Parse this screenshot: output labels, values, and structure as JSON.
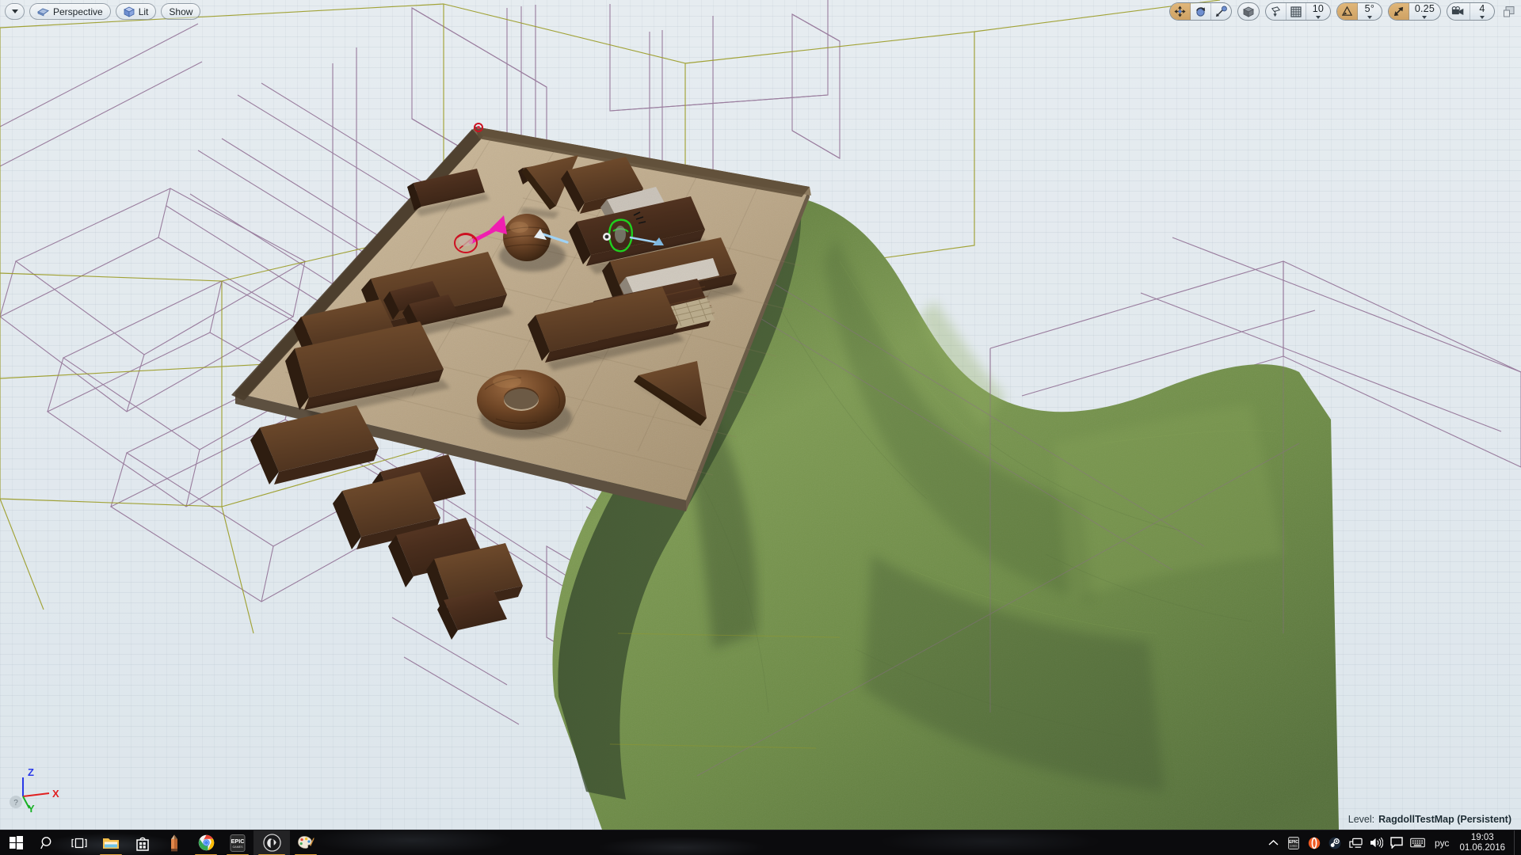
{
  "app": {
    "name": "Unreal Engine Editor",
    "level_label": "Level:",
    "level_name": "RagdollTestMap (Persistent)"
  },
  "viewport": {
    "toolbar_left": [
      {
        "name": "viewport-options-caret",
        "icon": "chevron-down-icon",
        "label": ""
      },
      {
        "name": "camera-mode",
        "icon": "camera-icon",
        "label": "Perspective"
      },
      {
        "name": "view-mode",
        "icon": "cube-icon",
        "label": "Lit"
      },
      {
        "name": "show-menu",
        "icon": "",
        "label": "Show"
      }
    ],
    "toolbar_right": {
      "transform_group": [
        {
          "name": "translate-mode",
          "icon": "move-icon",
          "active": true
        },
        {
          "name": "rotate-mode",
          "icon": "rotate-icon",
          "active": false
        },
        {
          "name": "scale-mode",
          "icon": "scale-icon",
          "active": false
        }
      ],
      "coord_group": [
        {
          "name": "world-coordinate-toggle",
          "icon": "globe-cube-icon",
          "active": false
        }
      ],
      "snap_group": [
        {
          "name": "surface-snap-toggle",
          "icon": "surface-snap-icon",
          "active": false
        },
        {
          "name": "grid-snap-toggle",
          "icon": "grid-icon",
          "active": false
        },
        {
          "name": "grid-snap-value",
          "icon": "",
          "value": "10",
          "active": false
        }
      ],
      "rotation_group": [
        {
          "name": "rotation-snap-toggle",
          "icon": "angle-icon",
          "active": true
        },
        {
          "name": "rotation-snap-value",
          "icon": "",
          "value": "5°",
          "active": false
        }
      ],
      "scale_group": [
        {
          "name": "scale-snap-toggle",
          "icon": "scale-arrow-icon",
          "active": true
        },
        {
          "name": "scale-snap-value",
          "icon": "",
          "value": "0.25",
          "active": false
        }
      ],
      "camera_group": [
        {
          "name": "camera-speed-toggle",
          "icon": "movie-camera-icon",
          "active": false
        },
        {
          "name": "camera-speed-value",
          "icon": "",
          "value": "4",
          "active": false
        }
      ],
      "maximize": {
        "name": "maximize-viewport-button",
        "icon": "maximize-icon"
      }
    },
    "axis_gizmo": {
      "z": "Z",
      "x": "X",
      "y": "Y",
      "z_color": "#2a39e8",
      "x_color": "#e02020",
      "y_color": "#17b024"
    },
    "colors": {
      "background": "#e3eaee",
      "wire_olive": "#9a9b22",
      "wire_purple": "#8d6a90",
      "floor_tan": "#b5a183",
      "wood_dark": "#4d3322",
      "grass_green": "#6e8c45",
      "selection_red": "#cc1122",
      "selection_green": "#1fd11f",
      "velocity_magenta": "#ef1fb0",
      "constraint_blue": "#9fd2f5",
      "toolbar_active": "#cfa263"
    }
  },
  "taskbar": {
    "items": [
      {
        "name": "start-button",
        "icon": "windows-logo-icon",
        "running": false,
        "active": false
      },
      {
        "name": "search-button",
        "icon": "search-icon",
        "running": false,
        "active": false
      },
      {
        "name": "task-view-button",
        "icon": "task-view-icon",
        "running": false,
        "active": false
      },
      {
        "name": "file-explorer-button",
        "icon": "folder-icon",
        "running": true,
        "active": false
      },
      {
        "name": "microsoft-store-button",
        "icon": "store-bag-icon",
        "running": false,
        "active": false
      },
      {
        "name": "sticky-notes-button",
        "icon": "pencil-icon",
        "running": false,
        "active": false
      },
      {
        "name": "google-chrome-button",
        "icon": "chrome-icon",
        "running": true,
        "active": false
      },
      {
        "name": "epic-games-launcher-button",
        "icon": "epic-games-icon",
        "running": true,
        "active": false
      },
      {
        "name": "unreal-engine-button",
        "icon": "unreal-engine-icon",
        "running": true,
        "active": true
      },
      {
        "name": "paint-button",
        "icon": "paint-palette-icon",
        "running": true,
        "active": false
      }
    ],
    "tray": [
      {
        "name": "show-hidden-icons-button",
        "icon": "chevron-up-icon"
      },
      {
        "name": "tray-epic-games",
        "icon": "epic-games-icon"
      },
      {
        "name": "tray-origin",
        "icon": "origin-icon"
      },
      {
        "name": "tray-steam",
        "icon": "steam-icon"
      },
      {
        "name": "tray-network",
        "icon": "network-icon"
      },
      {
        "name": "tray-volume",
        "icon": "speaker-icon"
      },
      {
        "name": "tray-action-center",
        "icon": "action-center-icon"
      },
      {
        "name": "tray-touch-keyboard",
        "icon": "keyboard-icon"
      }
    ],
    "language": "рус",
    "time": "19:03",
    "date": "01.06.2016"
  }
}
